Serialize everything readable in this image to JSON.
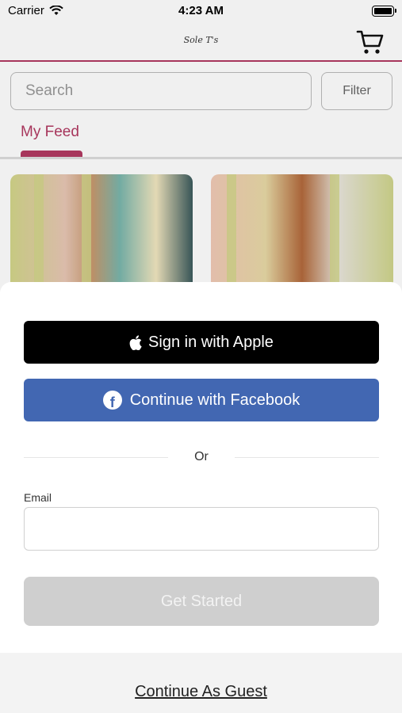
{
  "status_bar": {
    "carrier": "Carrier",
    "time": "4:23 AM"
  },
  "nav": {
    "logo_text": "Sole T's",
    "cart_icon": "shopping-cart-icon"
  },
  "search": {
    "placeholder": "Search",
    "filter_label": "Filter"
  },
  "tabs": [
    {
      "label": "My Feed",
      "active": true
    }
  ],
  "brand_color": "#b23a62",
  "sheet": {
    "apple_button_label": "Sign in with Apple",
    "facebook_button_label": "Continue with Facebook",
    "facebook_color": "#4267b2",
    "divider_text": "Or",
    "email_label": "Email",
    "email_value": "",
    "get_started_label": "Get Started",
    "guest_link": "Continue As Guest"
  }
}
